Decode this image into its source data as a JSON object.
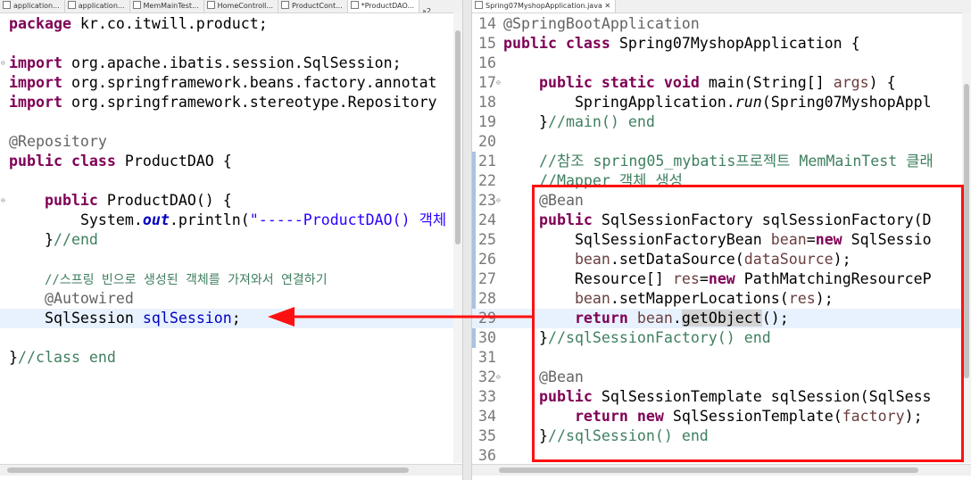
{
  "left_editor": {
    "tabs": [
      "application...",
      "application...",
      "MemMainTest...",
      "HomeControll...",
      "ProductCont...",
      "*ProductDAO..."
    ],
    "tab_overflow": "»2",
    "lines": {
      "l1_kw": "package",
      "l1_rest": " kr.co.itwill.product;",
      "l3_kw": "import",
      "l3_rest": " org.apache.ibatis.session.SqlSession;",
      "l4_kw": "import",
      "l4_rest": " org.springframework.beans.factory.annotat",
      "l5_kw": "import",
      "l5_rest": " org.springframework.stereotype.Repository",
      "l7_ann": "@Repository",
      "l8_kw1": "public",
      "l8_kw2": "class",
      "l8_rest": " ProductDAO {",
      "l10_kw": "public",
      "l10_rest": " ProductDAO() {",
      "l11_a": "System.",
      "l11_out": "out",
      "l11_b": ".println(",
      "l11_str": "\"-----ProductDAO() 객체",
      "l12_brace": "}",
      "l12_cm": "//end",
      "l14_cm": "//스프링 빈으로 생성된 객체를 가져와서 연결하기",
      "l15_ann": "@Autowired",
      "l16_type": "SqlSession ",
      "l16_fld": "sqlSession",
      "l16_end": ";",
      "l18_brace": "}",
      "l18_cm": "//class end"
    }
  },
  "right_editor": {
    "tab": "Spring07MyshopApplication.java",
    "lines": {
      "n14": "14",
      "r14_ann": "@SpringBootApplication",
      "n15": "15",
      "r15_kw1": "public",
      "r15_kw2": "class",
      "r15_rest": " Spring07MyshopApplication {",
      "n16": "16",
      "n17": "17",
      "r17_kw1": "public",
      "r17_kw2": "static",
      "r17_kw3": "void",
      "r17_a": " main(String[] ",
      "r17_p": "args",
      "r17_b": ") {",
      "n18": "18",
      "r18_a": "SpringApplication.",
      "r18_it": "run",
      "r18_b": "(Spring07MyshopAppl",
      "n19": "19",
      "r19_brace": "}",
      "r19_cm": "//main() end",
      "n20": "20",
      "n21": "21",
      "r21_cm": "//참조 spring05_mybatis프로젝트 MemMainTest 클래",
      "n22": "22",
      "r22_cm": "//Mapper 객체 생성",
      "n23": "23",
      "r23_ann": "@Bean",
      "n24": "24",
      "r24_kw": "public",
      "r24_rest": " SqlSessionFactory sqlSessionFactory(D",
      "n25": "25",
      "r25_a": "SqlSessionFactoryBean ",
      "r25_p": "bean",
      "r25_b": "=",
      "r25_kw": "new",
      "r25_c": " SqlSessio",
      "n26": "26",
      "r26_p": "bean",
      "r26_a": ".setDataSource(",
      "r26_p2": "dataSource",
      "r26_b": ");",
      "n27": "27",
      "r27_a": "Resource[] ",
      "r27_p": "res",
      "r27_b": "=",
      "r27_kw": "new",
      "r27_c": " PathMatchingResourceP",
      "n28": "28",
      "r28_p": "bean",
      "r28_a": ".setMapperLocations(",
      "r28_p2": "res",
      "r28_b": ");",
      "n29": "29",
      "r29_kw": "return",
      "r29_p": "bean",
      "r29_a": ".",
      "r29_occ": "getObject",
      "r29_b": "();",
      "n30": "30",
      "r30_brace": "}",
      "r30_cm": "//sqlSessionFactory() end",
      "n31": "31",
      "n32": "32",
      "r32_ann": "@Bean",
      "n33": "33",
      "r33_kw": "public",
      "r33_rest": " SqlSessionTemplate sqlSession(SqlSess",
      "n34": "34",
      "r34_kw1": "return",
      "r34_kw2": "new",
      "r34_a": " SqlSessionTemplate(",
      "r34_p": "factory",
      "r34_b": ");",
      "n35": "35",
      "r35_brace": "}",
      "r35_cm": "//sqlSession() end",
      "n36": "36"
    }
  },
  "colors": {
    "annotation_box": "#ff1010",
    "arrow": "#ff1010",
    "current_line": "#e8f2fe"
  }
}
